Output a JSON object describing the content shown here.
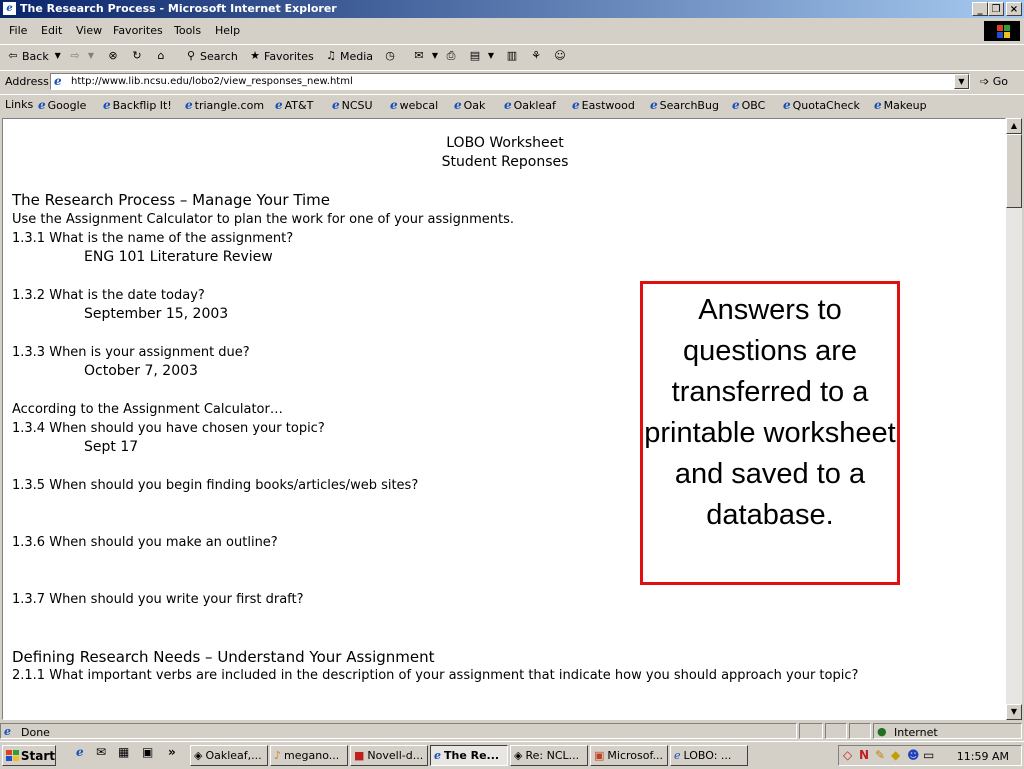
{
  "window": {
    "title": "The Research Process - Microsoft Internet Explorer",
    "minimize": "_",
    "restore": "❐",
    "close": "×"
  },
  "menu": [
    "File",
    "Edit",
    "View",
    "Favorites",
    "Tools",
    "Help"
  ],
  "toolbar": {
    "back": "Back",
    "search": "Search",
    "favorites": "Favorites",
    "media": "Media"
  },
  "address": {
    "label": "Address",
    "url": "http://www.lib.ncsu.edu/lobo2/view_responses_new.html",
    "go": "Go"
  },
  "links": {
    "label": "Links",
    "items": [
      "Google",
      "Backflip It!",
      "triangle.com",
      "AT&T",
      "NCSU",
      "webcal",
      "Oak",
      "Oakleaf",
      "Eastwood",
      "SearchBug",
      "OBC",
      "QuotaCheck",
      "Makeup"
    ]
  },
  "worksheet": {
    "title1": "LOBO Worksheet",
    "title2": "Student Reponses",
    "section1": {
      "heading": "The Research Process – Manage Your Time",
      "intro": "Use the Assignment Calculator to plan the work for one of your assignments.",
      "q1": "1.3.1  What is the name of the assignment?",
      "a1": "ENG 101 Literature Review",
      "q2": "1.3.2  What is the date today?",
      "a2": "September 15, 2003",
      "q3": "1.3.3  When is your assignment due?",
      "a3": "October 7, 2003",
      "according": "According to the Assignment Calculator…",
      "q4": "1.3.4  When should you have chosen your topic?",
      "a4": "Sept 17",
      "q5": "1.3.5  When should you begin finding books/articles/web sites?",
      "q6": "1.3.6  When should you make an outline?",
      "q7": "1.3.7  When should you write your first draft?"
    },
    "section2": {
      "heading": "Defining Research Needs – Understand Your Assignment",
      "q1": "2.1.1  What important verbs are included in the description of your assignment that indicate how you should approach your topic?"
    }
  },
  "callout": {
    "text": "Answers to questions are transferred to a printable worksheet and saved to a database."
  },
  "status": {
    "text": "Done",
    "zone": "Internet"
  },
  "taskbar": {
    "start": "Start",
    "tasks": [
      "Oakleaf,...",
      "megano...",
      "Novell-d...",
      "The Re...",
      "Re: NCL...",
      "Microsof...",
      "LOBO: ..."
    ],
    "clock": "11:59 AM"
  },
  "colors": {
    "callout_border": "#e01010",
    "title_gradient_start": "#0a246a",
    "ie_blue": "#1a52b8"
  }
}
